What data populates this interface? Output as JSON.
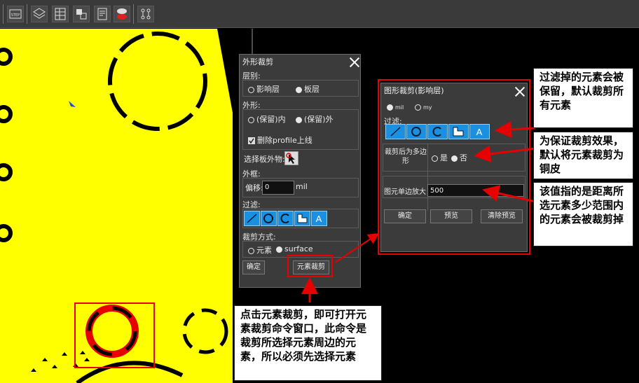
{
  "dialog_outline": {
    "title": "外形裁剪",
    "layer_label": "层别:",
    "layer_options": [
      "影响层",
      "板层"
    ],
    "shape_label": "外形:",
    "shape_options": [
      "(保留)内",
      "(保留)外"
    ],
    "delete_profile_label": "删除profile上线",
    "select_outer_label": "选择板外物:",
    "frame_label": "外框:",
    "offset_label": "偏移:",
    "offset_value": "0",
    "offset_unit": "mil",
    "filter_label": "过滤:",
    "crop_mode_label": "裁剪方式:",
    "crop_mode_options": [
      "元素",
      "surface"
    ],
    "ok_label": "确定",
    "element_crop_label": "元素裁剪"
  },
  "dialog_graphic": {
    "title": "图形裁剪(影响层)",
    "unit_options": [
      "mil",
      "my"
    ],
    "filter_label": "过滤:",
    "polygon_label": "裁剪后为多边形",
    "polygon_options": [
      "是",
      "否"
    ],
    "enlarge_label": "图元单边放大",
    "enlarge_value": "500",
    "ok_label": "确定",
    "preview_label": "预览",
    "clear_preview_label": "清除预览"
  },
  "filter_icons": [
    "line-icon",
    "circle-icon",
    "arc-icon",
    "surface-icon",
    "text-icon"
  ],
  "callouts": {
    "filter_note": "过滤掉的元素会被保留，默认裁剪所有元素",
    "polygon_note": "为保证裁剪效果，默认将元素裁剪为铜皮",
    "enlarge_note": "该值指的是距离所选元素多少范围内的元素会被裁剪掉",
    "crop_note": "点击元素裁剪，即可打开元素裁剪命令窗口，此命令是裁剪所选择元素周边的元素，所以必须先选择元素"
  },
  "colors": {
    "board": "#ffff00",
    "accent": "#1b8fe0",
    "highlight": "#e60000"
  }
}
